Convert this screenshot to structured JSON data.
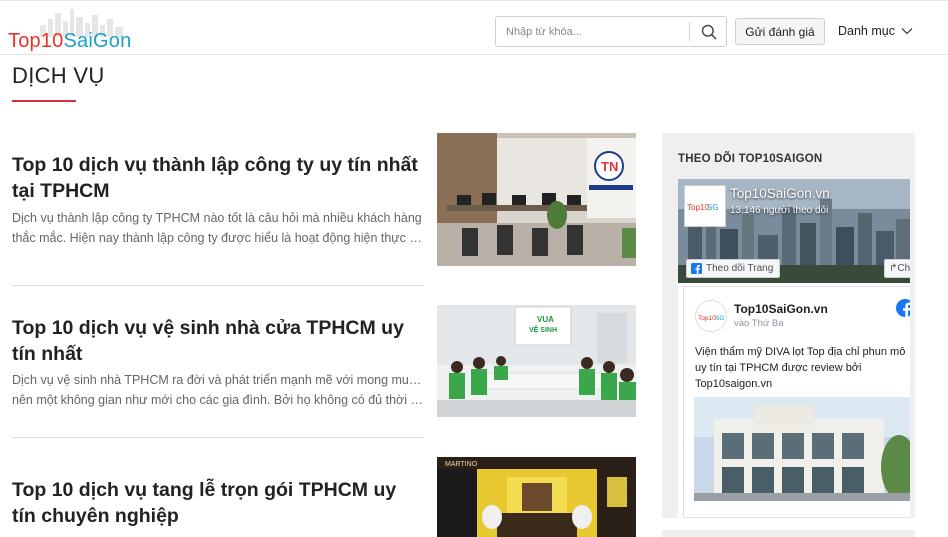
{
  "header": {
    "logo": {
      "part1": "Top10",
      "part2": "SaiGon"
    },
    "search": {
      "placeholder": "Nhập từ khóa..."
    },
    "review_button": "Gửi đánh giá",
    "category_button": "Danh mục"
  },
  "page": {
    "title": "DỊCH VỤ"
  },
  "articles": [
    {
      "title": "Top 10 dịch vụ thành lập công ty uy tín nhất tại TPHCM",
      "excerpt_line1": "Dịch vụ thành lập công ty TPHCM nào tốt là câu hỏi mà nhiều khách hàng",
      "excerpt_line2": "thắc mắc. Hiện nay thành lập công ty được hiểu là hoạt động hiện thực hóa ..."
    },
    {
      "title": "Top 10 dịch vụ vệ sinh nhà cửa TPHCM uy tín nhất",
      "excerpt_line1": "Dịch vụ vệ sinh nhà TPHCM ra đời và phát triển mạnh mẽ với mong muốn tạo",
      "excerpt_line2": "nên một không gian như mới cho các gia đình. Bởi họ không có đủ thời gian..."
    },
    {
      "title": "Top 10 dịch vụ tang lễ trọn gói TPHCM uy tín chuyên nghiệp",
      "excerpt_line1": "",
      "excerpt_line2": ""
    }
  ],
  "sidebar": {
    "title": "THEO DÕI TOP10SAIGON",
    "facebook": {
      "page_name": "Top10SaiGon.vn",
      "followers": "13.146 người theo dõi",
      "follow_button": "Theo dõi Trang",
      "share_button": "Ch",
      "post": {
        "author": "Top10SaiGon.vn",
        "time": "vào Thứ Ba",
        "text_line1": "Viện thẩm mỹ DIVA lọt Top địa chỉ phun mô",
        "text_line2": "uy tín tại TPHCM được review bởi",
        "text_line3": "Top10saigon.vn"
      }
    }
  },
  "colors": {
    "accent_red": "#e8342b",
    "accent_blue": "#1aa3c9",
    "underline": "#d0313a",
    "facebook_blue": "#1877f2"
  },
  "icons": {
    "search": "search-icon",
    "chevron": "chevron-down-icon",
    "facebook": "facebook-icon"
  }
}
